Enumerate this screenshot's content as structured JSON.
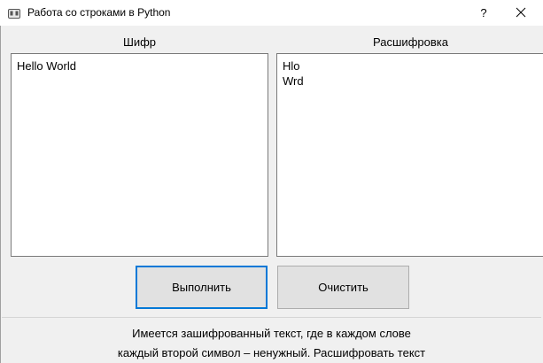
{
  "window": {
    "title": "Работа со строками в Python",
    "help_label": "?",
    "app_icon": "app-window-icon",
    "close_icon": "close-icon"
  },
  "cipher_panel": {
    "label": "Шифр",
    "value": "Hello World"
  },
  "decrypt_panel": {
    "label": "Расшифровка",
    "value": "Hlo\nWrd"
  },
  "buttons": {
    "run_label": "Выполнить",
    "clear_label": "Очистить"
  },
  "description": {
    "line1": "Имеется зашифрованный текст, где в каждом слове",
    "line2": "каждый второй символ – ненужный. Расшифровать текст"
  },
  "colors": {
    "focus_border": "#0078d7",
    "background": "#f0f0f0"
  }
}
